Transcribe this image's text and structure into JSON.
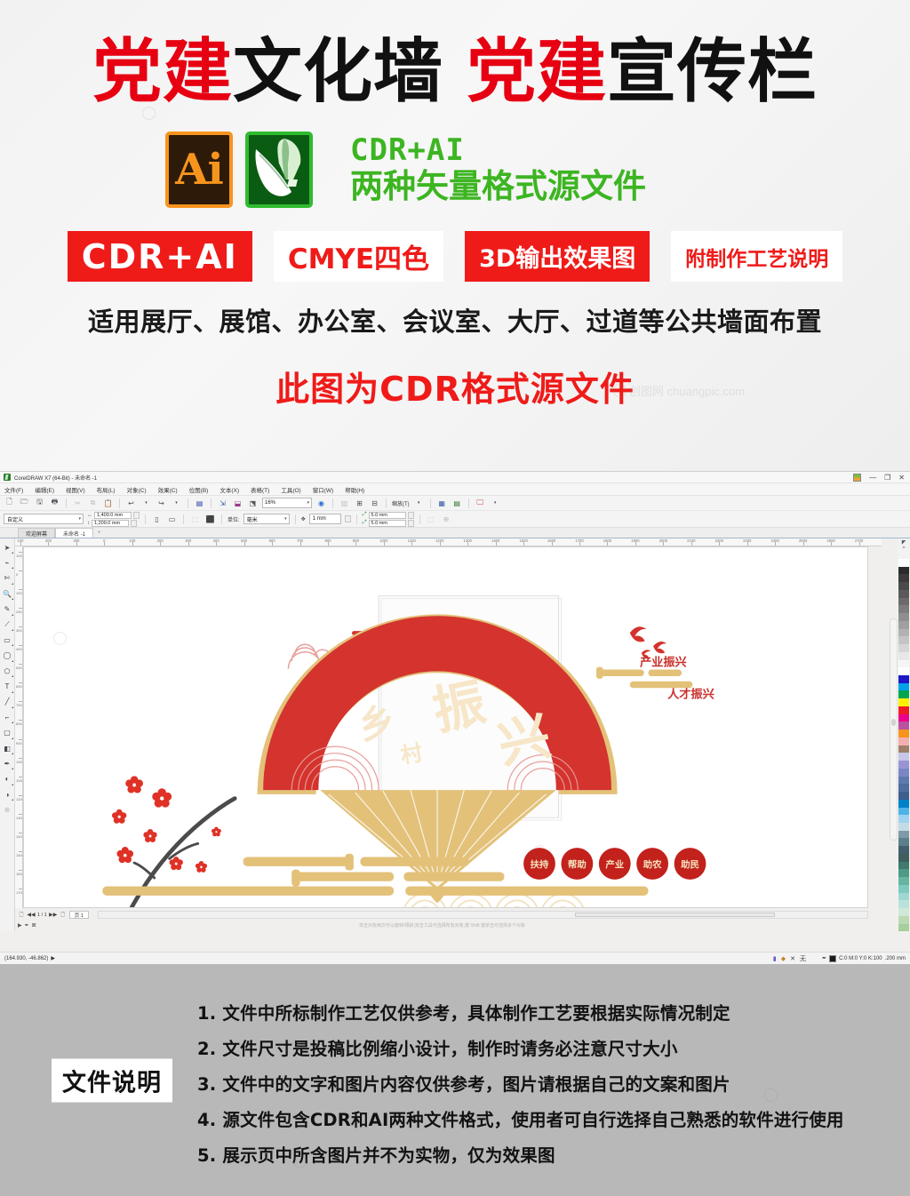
{
  "promo": {
    "title_parts": [
      {
        "text": "党建",
        "color": "red"
      },
      {
        "text": "文化墙",
        "color": "black"
      },
      {
        "text": "党建",
        "color": "red"
      },
      {
        "text": "宣传栏",
        "color": "black"
      }
    ],
    "title_red_color": "#e60012",
    "title_black_color": "#111111",
    "ai_icon_label": "Ai",
    "cdr_icon_label": "CorelDRAW",
    "format_line1": "CDR+AI",
    "format_line2": "两种矢量格式源文件",
    "format_green": "#3cb521",
    "badges": [
      {
        "label": "CDR+AI",
        "style": "filled"
      },
      {
        "label": "CMYE四色",
        "style": "outline"
      },
      {
        "label": "3D输出效果图",
        "style": "filled"
      },
      {
        "label": "附制作工艺说明",
        "style": "outline"
      }
    ],
    "badge_red": "#ef1b19",
    "applies_text": "适用展厅、展馆、办公室、会议室、大厅、过道等公共墙面布置",
    "format_note": "此图为CDR格式源文件"
  },
  "coreldraw": {
    "window_title": "CorelDRAW X7 (64-Bit) - 未命名 -1",
    "window_controls": {
      "minimize": "—",
      "restore": "❐",
      "close": "✕"
    },
    "menus": [
      "文件(F)",
      "编辑(E)",
      "视图(V)",
      "布局(L)",
      "对象(C)",
      "效果(C)",
      "位图(B)",
      "文本(X)",
      "表格(T)",
      "工具(O)",
      "窗口(W)",
      "帮助(H)"
    ],
    "toolbar_icons": [
      "new-icon",
      "open-icon",
      "save-icon",
      "print-icon",
      "cut-icon",
      "copy-icon",
      "paste-icon",
      "undo-icon",
      "redo-icon",
      "import-icon",
      "export-icon",
      "publish-pdf-icon",
      "application-launcher-icon"
    ],
    "zoom_level": "16%",
    "zoom_tool_label": "缩放(T)",
    "page_preset": "自定义",
    "page_width": "1,400.0 mm",
    "page_height": "1,200.0 mm",
    "units_label": "单位:",
    "units_value": "毫米",
    "nudge_value": "1 mm",
    "duplicate_x": "5.0 mm",
    "duplicate_y": "5.0 mm",
    "tabs": [
      {
        "label": "欢迎屏幕",
        "active": false
      },
      {
        "label": "未命名 -1",
        "active": true
      },
      {
        "label": "+",
        "active": false
      }
    ],
    "toolbox": [
      "pick-tool-icon",
      "shape-tool-icon",
      "crop-tool-icon",
      "zoom-tool-icon",
      "freehand-tool-icon",
      "smart-fill-tool-icon",
      "rectangle-tool-icon",
      "ellipse-tool-icon",
      "polygon-tool-icon",
      "text-tool-icon",
      "parallel-dimension-tool-icon",
      "straight-line-connector-icon",
      "drop-shadow-tool-icon",
      "transparency-tool-icon",
      "color-eyedropper-icon",
      "interactive-fill-tool-icon",
      "smart-drawing-tool-icon",
      "add-tool-icon"
    ],
    "ruler_labels_h": [
      "100",
      "200",
      "300",
      "0",
      "100",
      "200",
      "300",
      "400",
      "500",
      "600",
      "700",
      "800",
      "900",
      "1000",
      "1100",
      "1200",
      "1300",
      "1400",
      "1500",
      "1600",
      "1700",
      "1800",
      "1900",
      "2000",
      "2100",
      "2200",
      "2300",
      "2400",
      "2500",
      "2600",
      "2700"
    ],
    "ruler_labels_v": [
      "100",
      "0",
      "100",
      "200",
      "300",
      "400",
      "500",
      "600",
      "700",
      "800",
      "900",
      "1000",
      "1100",
      "1200",
      "1300",
      "1400",
      "1500",
      "1600",
      "1700"
    ],
    "status": {
      "coordinates": "(164.930, -46.862)",
      "page_indicator": "1 / 1",
      "page_name": "页 1",
      "hint": "单击对象两次可以旋转/倾斜;双击工具可选择所有对象;按 Shift 键单击可选择多个对象",
      "color_info": "C:0 M:0 Y:0 K:100",
      "outline_width": ".200 mm",
      "fill_label": "无"
    },
    "palette_colors": [
      "#ffffff",
      "#2b2b2b",
      "#3b3b3b",
      "#4a4a4a",
      "#5a5a5a",
      "#6b6b6b",
      "#7d7d7d",
      "#8f8f8f",
      "#a0a0a0",
      "#b2b2b2",
      "#c4c4c4",
      "#d6d6d6",
      "#e8e8e8",
      "#f6f6f6",
      "#ffffff",
      "#1c18c8",
      "#00a3e8",
      "#00a550",
      "#fff200",
      "#ed1c24",
      "#ec008c",
      "#b9529f",
      "#f7941e",
      "#f4aeae",
      "#9e7f68",
      "#c7c6e8",
      "#9a94d4",
      "#7b86c4",
      "#5d7ab0",
      "#4f6d9e",
      "#3e5e8c",
      "#0082c8",
      "#4eb3e6",
      "#9dd3ef",
      "#c3dbe6",
      "#7f9aa8",
      "#5d7f8c",
      "#425f6b",
      "#3f5f5c",
      "#3f7a6e",
      "#4e9a86",
      "#66b5a0",
      "#7fcac0",
      "#9fd8d0",
      "#b9e3da",
      "#cfe8d8",
      "#bcd9b4",
      "#a6cf9b"
    ]
  },
  "artwork": {
    "main_title": "振兴",
    "sub_title": "乡村",
    "side_text_1": "产业振兴",
    "side_text_2": "人才振兴",
    "badges": [
      "扶持",
      "帮助",
      "产业",
      "助农",
      "助民"
    ],
    "fan_red": "#d4332e",
    "gold": "#e3c179"
  },
  "footer": {
    "label": "文件说明",
    "notes": [
      "1. 文件中所标制作工艺仅供参考，具体制作工艺要根据实际情况制定",
      "2. 文件尺寸是投稿比例缩小设计，制作时请务必注意尺寸大小",
      "3. 文件中的文字和图片内容仅供参考，图片请根据自己的文案和图片",
      "4. 源文件包含CDR和AI两种文件格式，使用者可自行选择自己熟悉的软件进行使用",
      "5. 展示页中所含图片并不为实物，仅为效果图"
    ],
    "background": "#b8b8b8"
  },
  "watermark": {
    "text": "创图网  chuangpic.com"
  }
}
